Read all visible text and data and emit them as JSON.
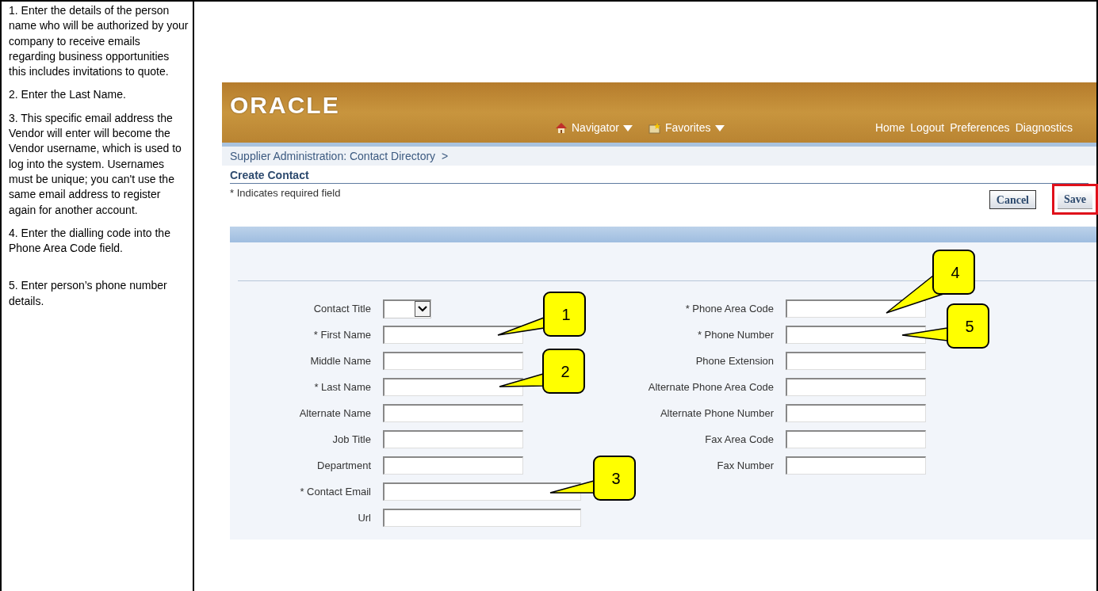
{
  "instructions": [
    "1. Enter the details of the person name who will be authorized by your company to receive emails regarding business opportunities this includes invitations to quote.",
    "2. Enter the Last Name.",
    "3. This specific email address the Vendor will enter will become the Vendor username, which is used to log into the system. Usernames must be unique; you can't use the same email address to register again for another account.",
    "4. Enter the dialling code into the Phone Area Code field.",
    "5. Enter person’s phone number details."
  ],
  "app": {
    "logo": "ORACLE",
    "nav_menus": [
      "Navigator",
      "Favorites"
    ],
    "global_links": [
      "Home",
      "Logout",
      "Preferences",
      "Diagnostics"
    ],
    "breadcrumb": "Supplier Administration: Contact Directory  >",
    "page_title": "Create Contact",
    "required_note": "* Indicates required field",
    "buttons": [
      {
        "label": "Cancel",
        "highlighted": false
      },
      {
        "label": "Save",
        "highlighted": true
      }
    ],
    "left_fields": [
      {
        "label": "Contact Title",
        "kind": "select"
      },
      {
        "label": "* First Name",
        "kind": "text"
      },
      {
        "label": "Middle Name",
        "kind": "text"
      },
      {
        "label": "* Last Name",
        "kind": "text"
      },
      {
        "label": "Alternate Name",
        "kind": "text"
      },
      {
        "label": "Job Title",
        "kind": "text"
      },
      {
        "label": "Department",
        "kind": "text"
      },
      {
        "label": "* Contact Email",
        "kind": "longtext"
      },
      {
        "label": "Url",
        "kind": "longtext"
      }
    ],
    "right_fields": [
      {
        "label": "* Phone Area Code",
        "kind": "text"
      },
      {
        "label": "* Phone Number",
        "kind": "text"
      },
      {
        "label": "Phone Extension",
        "kind": "text"
      },
      {
        "label": "Alternate Phone Area Code",
        "kind": "text"
      },
      {
        "label": "Alternate Phone Number",
        "kind": "text"
      },
      {
        "label": "Fax Area Code",
        "kind": "text"
      },
      {
        "label": "Fax Number",
        "kind": "text"
      }
    ]
  },
  "callouts": [
    "1",
    "2",
    "3",
    "4",
    "5"
  ]
}
